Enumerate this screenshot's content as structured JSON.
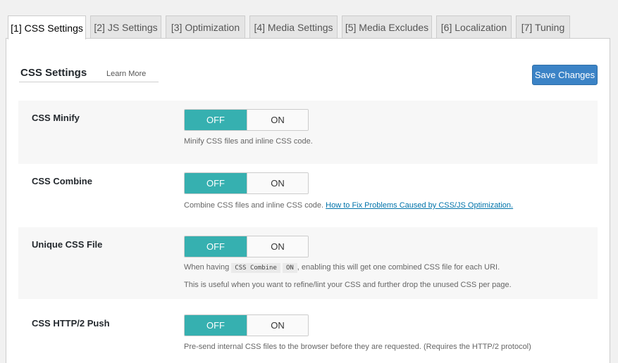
{
  "tabs": [
    {
      "label": "[1] CSS Settings",
      "active": true
    },
    {
      "label": "[2] JS Settings"
    },
    {
      "label": "[3] Optimization"
    },
    {
      "label": "[4] Media Settings"
    },
    {
      "label": "[5] Media Excludes"
    },
    {
      "label": "[6] Localization"
    },
    {
      "label": "[7] Tuning"
    }
  ],
  "section": {
    "title": "CSS Settings",
    "learn_more": "Learn More",
    "save_label": "Save Changes"
  },
  "toggle_labels": {
    "off": "OFF",
    "on": "ON"
  },
  "settings": [
    {
      "label": "CSS Minify",
      "state": "OFF",
      "desc": "Minify CSS files and inline CSS code."
    },
    {
      "label": "CSS Combine",
      "state": "OFF",
      "desc": "Combine CSS files and inline CSS code.",
      "link": "How to Fix Problems Caused by CSS/JS Optimization."
    },
    {
      "label": "Unique CSS File",
      "state": "OFF",
      "desc_prefix": "When having",
      "code1": "CSS Combine",
      "code2": "ON",
      "desc_suffix": ", enabling this will get one combined CSS file for each URI.",
      "desc2": "This is useful when you want to refine/lint your CSS and further drop the unused CSS per page."
    },
    {
      "label": "CSS HTTP/2 Push",
      "state": "OFF",
      "desc": "Pre-send internal CSS files to the browser before they are requested. (Requires the HTTP/2 protocol)"
    }
  ]
}
